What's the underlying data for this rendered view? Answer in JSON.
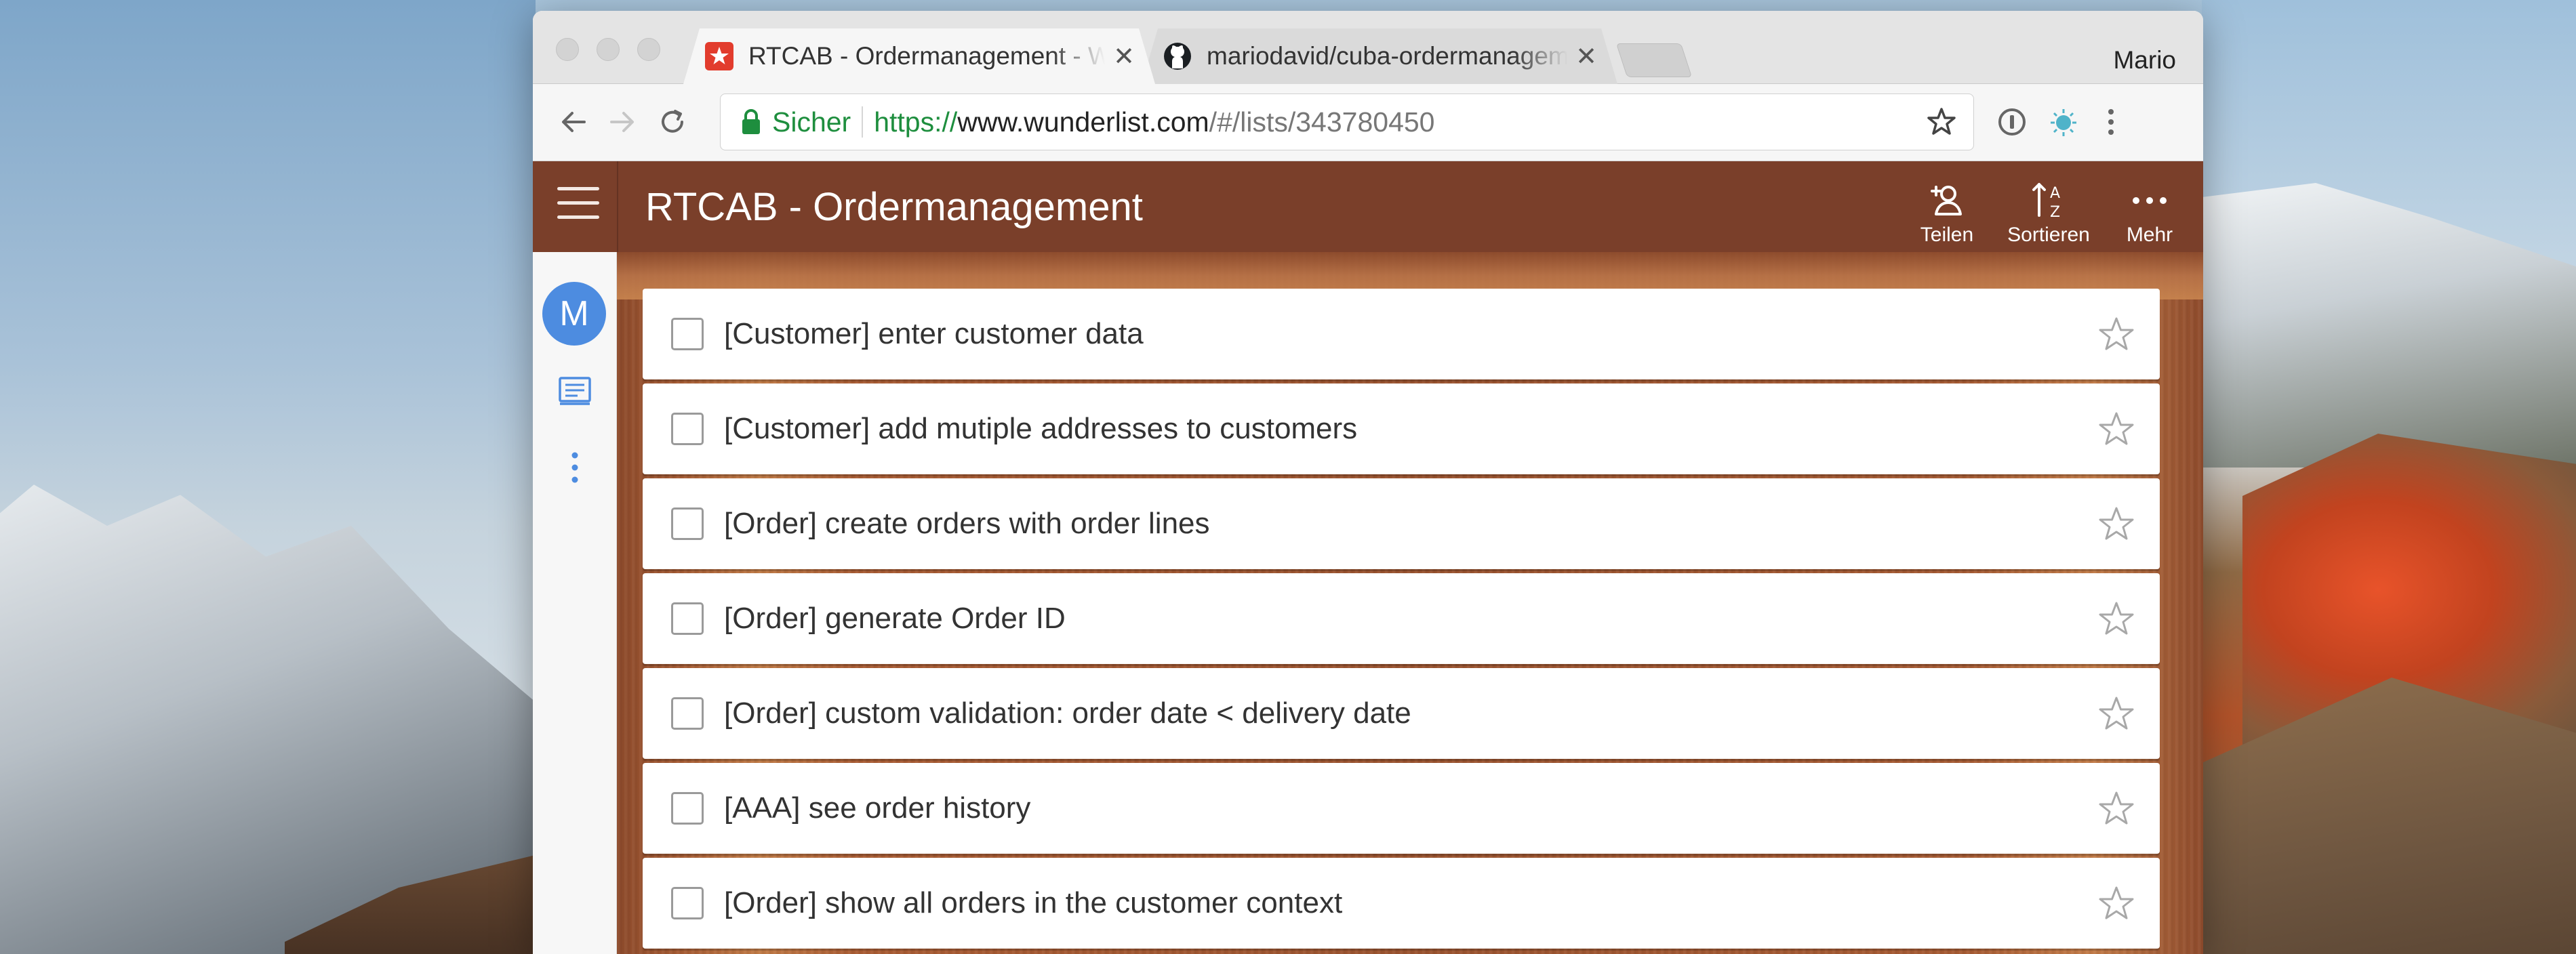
{
  "browser": {
    "tabs": [
      {
        "label": "RTCAB - Ordermanagement - Wunderlist",
        "favicon": "wunderlist-star-icon",
        "active": true
      },
      {
        "label": "mariodavid/cuba-ordermanagement",
        "favicon": "github-octocat-icon",
        "active": false
      }
    ],
    "profile_name": "Mario",
    "omnibox": {
      "secure_label": "Sicher",
      "url_scheme": "https://",
      "url_host": "www.wunderlist.com",
      "url_path": "/#/lists/343780450"
    }
  },
  "app": {
    "list_title": "RTCAB - Ordermanagement",
    "actions": [
      {
        "label": "Teilen",
        "icon": "share-user-icon"
      },
      {
        "label": "Sortieren",
        "icon": "sort-az-icon"
      },
      {
        "label": "Mehr",
        "icon": "more-dots-icon"
      }
    ],
    "sidebar": {
      "avatar_initial": "M"
    },
    "tasks": [
      {
        "title": "[Customer] enter customer data",
        "done": false,
        "starred": false
      },
      {
        "title": "[Customer] add mutiple addresses to customers",
        "done": false,
        "starred": false
      },
      {
        "title": "[Order] create orders with order lines",
        "done": false,
        "starred": false
      },
      {
        "title": "[Order] generate Order ID",
        "done": false,
        "starred": false
      },
      {
        "title": "[Order] custom validation: order date < delivery date",
        "done": false,
        "starred": false
      },
      {
        "title": "[AAA] see order history",
        "done": false,
        "starred": false
      },
      {
        "title": "[Order] show all orders in the customer context",
        "done": false,
        "starred": false
      }
    ]
  },
  "colors": {
    "header_bg": "#7a3f2a",
    "avatar_bg": "#4d8ce0",
    "secure_green": "#1e8e3e"
  }
}
